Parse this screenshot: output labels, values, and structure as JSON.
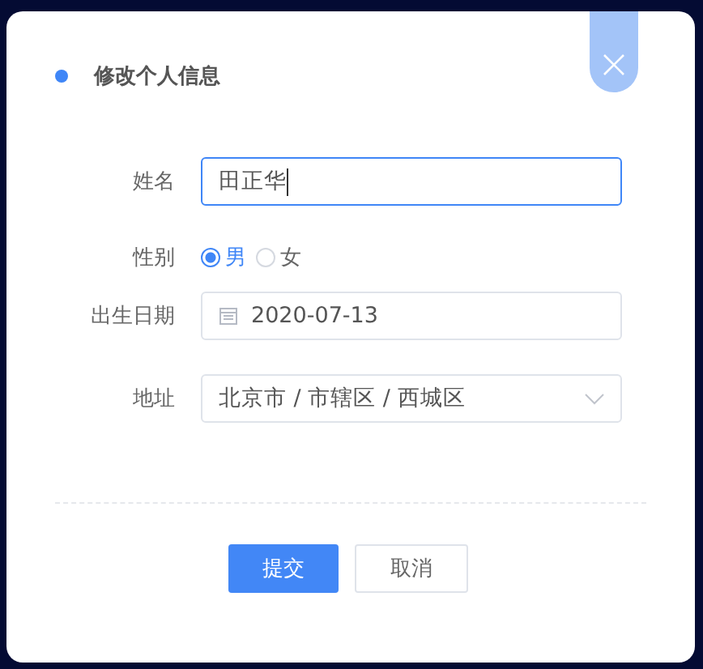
{
  "dialog": {
    "title": "修改个人信息"
  },
  "fields": [
    {
      "kind": "text",
      "label": "姓名",
      "value": "田正华",
      "focused": true
    },
    {
      "kind": "radio",
      "label": "性别",
      "options": [
        {
          "label": "男",
          "selected": true
        },
        {
          "label": "女",
          "selected": false
        }
      ]
    },
    {
      "kind": "date",
      "label": "出生日期",
      "value": "2020-07-13"
    },
    {
      "kind": "select",
      "label": "地址",
      "value": "北京市 / 市辖区 / 西城区"
    }
  ],
  "buttons": [
    {
      "kind": "primary",
      "label": "提交"
    },
    {
      "kind": "default",
      "label": "取消"
    }
  ]
}
